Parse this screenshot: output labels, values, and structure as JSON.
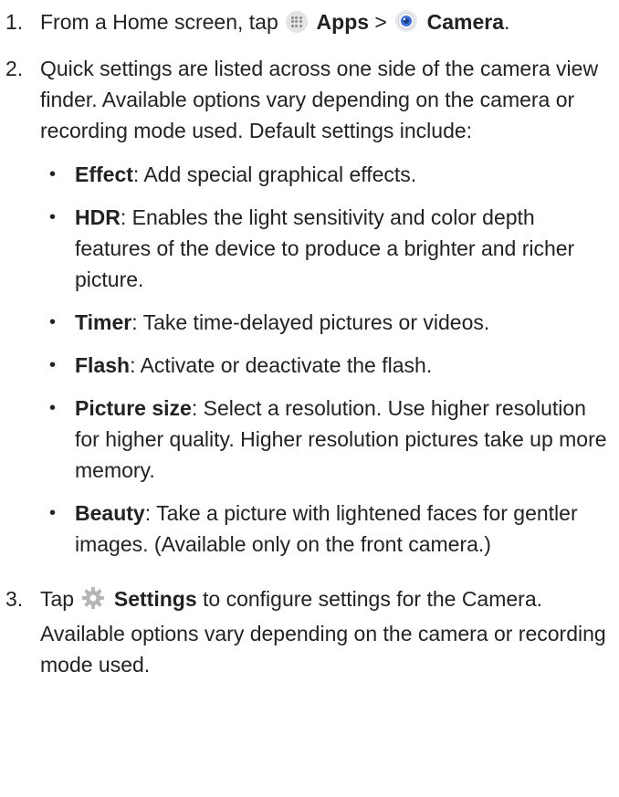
{
  "steps": [
    {
      "number": "1.",
      "pre": "From a Home screen, tap ",
      "apps_label": "Apps",
      "separator": " > ",
      "camera_label": "Camera",
      "end": "."
    },
    {
      "number": "2.",
      "text": "Quick settings are listed across one side of the camera view finder. Available options vary depending on the camera or recording mode used. Default settings include:",
      "bullets": [
        {
          "term": "Effect",
          "desc": ": Add special graphical effects."
        },
        {
          "term": "HDR",
          "desc": ": Enables the light sensitivity and color depth features of the device to produce a brighter and richer picture."
        },
        {
          "term": "Timer",
          "desc": ": Take time-delayed pictures or videos."
        },
        {
          "term": "Flash",
          "desc": ": Activate or deactivate the flash."
        },
        {
          "term": "Picture size",
          "desc": ": Select a resolution. Use higher resolution for higher quality. Higher resolution pictures take up more memory."
        },
        {
          "term": "Beauty",
          "desc": ": Take a picture with lightened faces for gentler images. (Available only on the front camera.)"
        }
      ]
    },
    {
      "number": "3.",
      "pre": "Tap ",
      "settings_label": "Settings",
      "post": " to configure settings for the Camera. Available options vary depending on the camera or recording mode used."
    }
  ],
  "bullet_char": "•",
  "icons": {
    "apps": "apps-grid-icon",
    "camera": "camera-icon",
    "settings": "gear-icon"
  },
  "colors": {
    "text": "#222222",
    "camera_blue": "#3b6fd6",
    "gear_gray": "#b5b5b5"
  }
}
